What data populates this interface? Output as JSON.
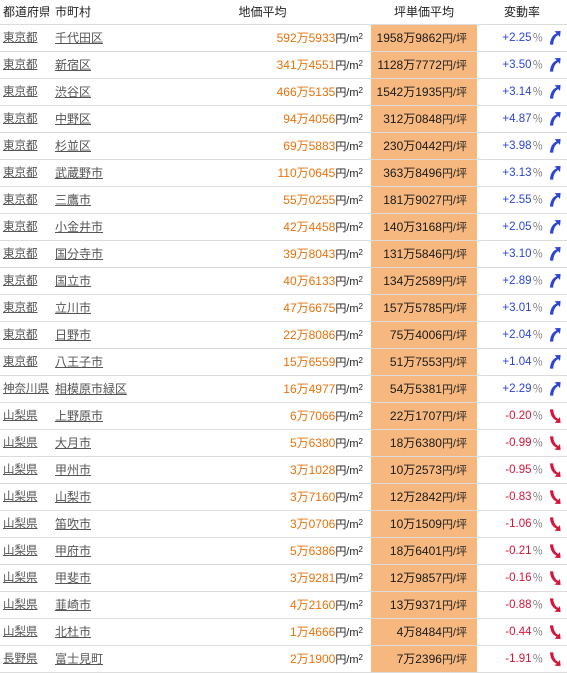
{
  "table": {
    "headers": {
      "prefecture": "都道府県",
      "municipality": "市町村",
      "price_sqm": "地価平均",
      "price_tsubo": "坪単価平均",
      "change_rate": "変動率"
    },
    "units": {
      "sqm": "円/m",
      "sqm_sup": "2",
      "tsubo": "円/坪",
      "percent": "％"
    },
    "colors": {
      "price_orange": "#e8720c",
      "tsubo_column_bg": "#f6b87e",
      "rate_up": "#2b44d6",
      "rate_down": "#d6153a",
      "link": "#555555",
      "row_divider": "#dcdcdc"
    },
    "icons": {
      "up": "arrow-up-right-icon",
      "down": "arrow-down-right-icon"
    },
    "rows": [
      {
        "prefecture": "東京都",
        "municipality": "千代田区",
        "sqm_value": "592万5933",
        "tsubo_value": "1958万9862",
        "rate": "+2.25",
        "direction": "up"
      },
      {
        "prefecture": "東京都",
        "municipality": "新宿区",
        "sqm_value": "341万4551",
        "tsubo_value": "1128万7772",
        "rate": "+3.50",
        "direction": "up"
      },
      {
        "prefecture": "東京都",
        "municipality": "渋谷区",
        "sqm_value": "466万5135",
        "tsubo_value": "1542万1935",
        "rate": "+3.14",
        "direction": "up"
      },
      {
        "prefecture": "東京都",
        "municipality": "中野区",
        "sqm_value": "94万4056",
        "tsubo_value": "312万0848",
        "rate": "+4.87",
        "direction": "up"
      },
      {
        "prefecture": "東京都",
        "municipality": "杉並区",
        "sqm_value": "69万5883",
        "tsubo_value": "230万0442",
        "rate": "+3.98",
        "direction": "up"
      },
      {
        "prefecture": "東京都",
        "municipality": "武蔵野市",
        "sqm_value": "110万0645",
        "tsubo_value": "363万8496",
        "rate": "+3.13",
        "direction": "up"
      },
      {
        "prefecture": "東京都",
        "municipality": "三鷹市",
        "sqm_value": "55万0255",
        "tsubo_value": "181万9027",
        "rate": "+2.55",
        "direction": "up"
      },
      {
        "prefecture": "東京都",
        "municipality": "小金井市",
        "sqm_value": "42万4458",
        "tsubo_value": "140万3168",
        "rate": "+2.05",
        "direction": "up"
      },
      {
        "prefecture": "東京都",
        "municipality": "国分寺市",
        "sqm_value": "39万8043",
        "tsubo_value": "131万5846",
        "rate": "+3.10",
        "direction": "up"
      },
      {
        "prefecture": "東京都",
        "municipality": "国立市",
        "sqm_value": "40万6133",
        "tsubo_value": "134万2589",
        "rate": "+2.89",
        "direction": "up"
      },
      {
        "prefecture": "東京都",
        "municipality": "立川市",
        "sqm_value": "47万6675",
        "tsubo_value": "157万5785",
        "rate": "+3.01",
        "direction": "up"
      },
      {
        "prefecture": "東京都",
        "municipality": "日野市",
        "sqm_value": "22万8086",
        "tsubo_value": "75万4006",
        "rate": "+2.04",
        "direction": "up"
      },
      {
        "prefecture": "東京都",
        "municipality": "八王子市",
        "sqm_value": "15万6559",
        "tsubo_value": "51万7553",
        "rate": "+1.04",
        "direction": "up"
      },
      {
        "prefecture": "神奈川県",
        "municipality": "相模原市緑区",
        "sqm_value": "16万4977",
        "tsubo_value": "54万5381",
        "rate": "+2.29",
        "direction": "up"
      },
      {
        "prefecture": "山梨県",
        "municipality": "上野原市",
        "sqm_value": "6万7066",
        "tsubo_value": "22万1707",
        "rate": "-0.20",
        "direction": "down"
      },
      {
        "prefecture": "山梨県",
        "municipality": "大月市",
        "sqm_value": "5万6380",
        "tsubo_value": "18万6380",
        "rate": "-0.99",
        "direction": "down"
      },
      {
        "prefecture": "山梨県",
        "municipality": "甲州市",
        "sqm_value": "3万1028",
        "tsubo_value": "10万2573",
        "rate": "-0.95",
        "direction": "down"
      },
      {
        "prefecture": "山梨県",
        "municipality": "山梨市",
        "sqm_value": "3万7160",
        "tsubo_value": "12万2842",
        "rate": "-0.83",
        "direction": "down"
      },
      {
        "prefecture": "山梨県",
        "municipality": "笛吹市",
        "sqm_value": "3万0706",
        "tsubo_value": "10万1509",
        "rate": "-1.06",
        "direction": "down"
      },
      {
        "prefecture": "山梨県",
        "municipality": "甲府市",
        "sqm_value": "5万6386",
        "tsubo_value": "18万6401",
        "rate": "-0.21",
        "direction": "down"
      },
      {
        "prefecture": "山梨県",
        "municipality": "甲斐市",
        "sqm_value": "3万9281",
        "tsubo_value": "12万9857",
        "rate": "-0.16",
        "direction": "down"
      },
      {
        "prefecture": "山梨県",
        "municipality": "韮崎市",
        "sqm_value": "4万2160",
        "tsubo_value": "13万9371",
        "rate": "-0.88",
        "direction": "down"
      },
      {
        "prefecture": "山梨県",
        "municipality": "北杜市",
        "sqm_value": "1万4666",
        "tsubo_value": "4万8484",
        "rate": "-0.44",
        "direction": "down"
      },
      {
        "prefecture": "長野県",
        "municipality": "富士見町",
        "sqm_value": "2万1900",
        "tsubo_value": "7万2396",
        "rate": "-1.91",
        "direction": "down"
      }
    ]
  }
}
